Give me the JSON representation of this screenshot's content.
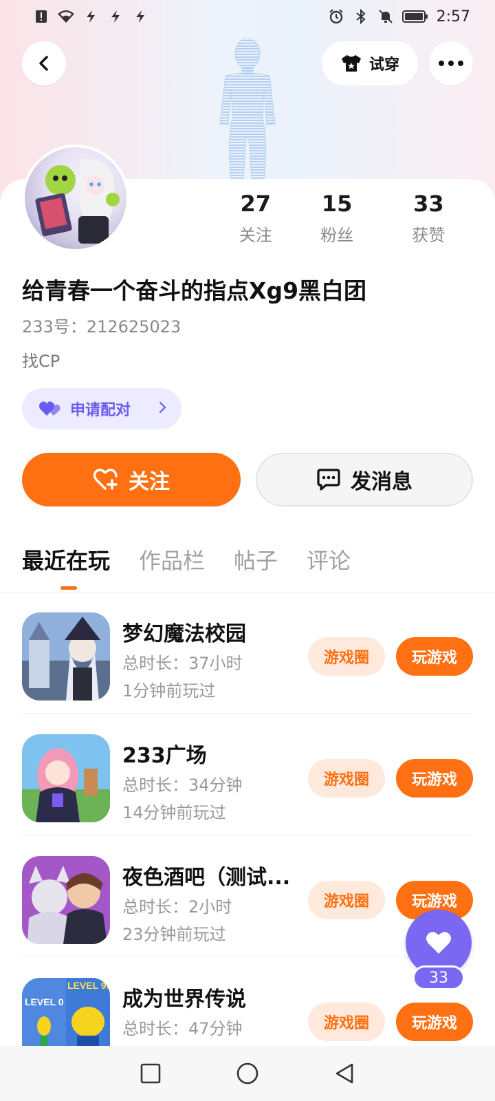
{
  "status_bar": {
    "time": "2:57",
    "left_icons": [
      "alert-icon",
      "wifi-icon",
      "bolt-icon",
      "bolt-icon",
      "bolt-icon"
    ],
    "right_icons": [
      "alarm-icon",
      "bluetooth-icon",
      "mute-icon",
      "battery-icon"
    ]
  },
  "header": {
    "tryon_label": "试穿"
  },
  "profile": {
    "stats": [
      {
        "value": "27",
        "label": "关注"
      },
      {
        "value": "15",
        "label": "粉丝"
      },
      {
        "value": "33",
        "label": "获赞"
      }
    ],
    "nickname": "给青春一个奋斗的指点Xg9黑白团",
    "uid": "233号：212625023",
    "bio": "找CP",
    "pair_label": "申请配对",
    "follow_label": "关注",
    "message_label": "发消息"
  },
  "tabs": [
    {
      "label": "最近在玩",
      "active": true
    },
    {
      "label": "作品栏",
      "active": false
    },
    {
      "label": "帖子",
      "active": false
    },
    {
      "label": "评论",
      "active": false
    }
  ],
  "games": [
    {
      "title": "梦幻魔法校园",
      "total_time": "总时长：37小时",
      "last_played": "1分钟前玩过",
      "circle_label": "游戏圈",
      "play_label": "玩游戏"
    },
    {
      "title": "233广场",
      "total_time": "总时长：34分钟",
      "last_played": "14分钟前玩过",
      "circle_label": "游戏圈",
      "play_label": "玩游戏"
    },
    {
      "title": "夜色酒吧（测试...",
      "total_time": "总时长：2小时",
      "last_played": "23分钟前玩过",
      "circle_label": "游戏圈",
      "play_label": "玩游戏"
    },
    {
      "title": "成为世界传说",
      "total_time": "总时长：47分钟",
      "last_played": "",
      "circle_label": "游戏圈",
      "play_label": "玩游戏"
    }
  ],
  "like_fab": {
    "count": "33"
  },
  "colors": {
    "accent": "#ff7013",
    "purple": "#7a67f2",
    "pair_bg": "#ecebff"
  }
}
